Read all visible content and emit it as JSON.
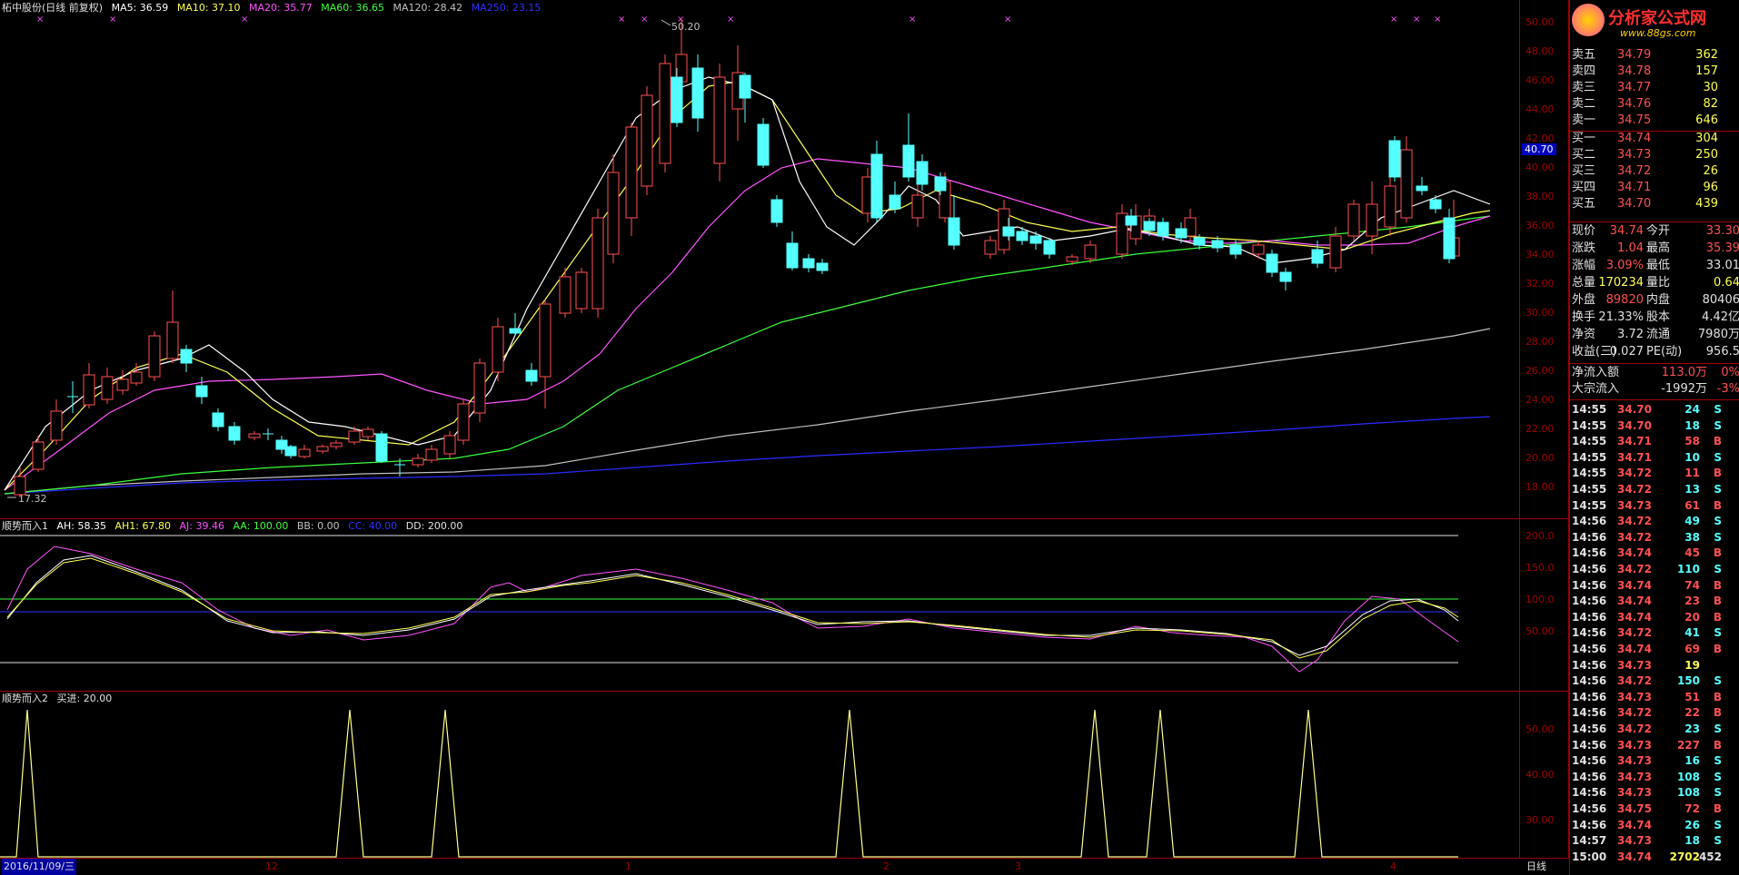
{
  "main_header": {
    "title": "柘中股份(日线 前复权)",
    "ma5": "MA5: 36.59",
    "ma10": "MA10: 37.10",
    "ma20": "MA20: 35.77",
    "ma60": "MA60: 36.65",
    "ma120": "MA120: 28.42",
    "ma250": "MA250: 23.15"
  },
  "ind1_header": {
    "title": "顺势而入1",
    "ah": "AH: 58.35",
    "ah1": "AH1: 67.80",
    "aj": "AJ: 39.46",
    "aa": "AA: 100.00",
    "bb": "BB: 0.00",
    "cc": "CC: 40.00",
    "dd": "DD: 200.00"
  },
  "ind2_header": {
    "title": "顺势而入2",
    "buy": "买进: 20.00"
  },
  "price_axis": [
    "50.00",
    "48.00",
    "46.00",
    "44.00",
    "42.00",
    "40.00",
    "38.00",
    "36.00",
    "34.00",
    "32.00",
    "30.00",
    "28.00",
    "26.00",
    "24.00",
    "22.00",
    "20.00",
    "18.00"
  ],
  "price_flag": "40.70",
  "high_label": "50.20",
  "low_label": "17.32",
  "ind1_axis": [
    "200.0",
    "150.0",
    "100.0",
    "50.00"
  ],
  "ind2_axis": [
    "50.00",
    "40.00",
    "30.00"
  ],
  "date_axis": {
    "start": "2016/11/09/三",
    "m12": "12",
    "m1": "1",
    "m2": "2",
    "m3": "3",
    "m4": "4"
  },
  "period_label": "日线",
  "logo": {
    "title": "分析家公式网",
    "url": "www.88gs.com"
  },
  "order_book": [
    {
      "label": "卖五",
      "price": "34.79",
      "vol": "362"
    },
    {
      "label": "卖四",
      "price": "34.78",
      "vol": "157"
    },
    {
      "label": "卖三",
      "price": "34.77",
      "vol": "30"
    },
    {
      "label": "卖二",
      "price": "34.76",
      "vol": "82"
    },
    {
      "label": "卖一",
      "price": "34.75",
      "vol": "646"
    },
    {
      "label": "买一",
      "price": "34.74",
      "vol": "304"
    },
    {
      "label": "买二",
      "price": "34.73",
      "vol": "250"
    },
    {
      "label": "买三",
      "price": "34.72",
      "vol": "26"
    },
    {
      "label": "买四",
      "price": "34.71",
      "vol": "96"
    },
    {
      "label": "买五",
      "price": "34.70",
      "vol": "439"
    }
  ],
  "stats": [
    {
      "l1": "现价",
      "v1": "34.74",
      "l2": "今开",
      "v2": "33.30",
      "c1": "red",
      "c2": "red"
    },
    {
      "l1": "涨跌",
      "v1": "1.04",
      "l2": "最高",
      "v2": "35.39",
      "c1": "red",
      "c2": "red"
    },
    {
      "l1": "涨幅",
      "v1": "3.09%",
      "l2": "最低",
      "v2": "33.01",
      "c1": "red",
      "c2": "wht"
    },
    {
      "l1": "总量",
      "v1": "170234",
      "l2": "量比",
      "v2": "0.64",
      "c1": "yel",
      "c2": "yel"
    },
    {
      "l1": "外盘",
      "v1": "89820",
      "l2": "内盘",
      "v2": "80406",
      "c1": "red",
      "c2": "wht"
    },
    {
      "l1": "换手",
      "v1": "21.33%",
      "l2": "股本",
      "v2": "4.42亿",
      "c1": "wht",
      "c2": "wht"
    },
    {
      "l1": "净资",
      "v1": "3.72",
      "l2": "流通",
      "v2": "7980万",
      "c1": "wht",
      "c2": "wht"
    },
    {
      "l1": "收益(三)",
      "v1": "0.027",
      "l2": "PE(动)",
      "v2": "956.5",
      "c1": "wht",
      "c2": "wht"
    }
  ],
  "flow": [
    {
      "label": "净流入额",
      "value": "113.0万",
      "pct": "0%"
    },
    {
      "label": "大宗流入",
      "value": "-1992万",
      "pct": "-3%"
    }
  ],
  "ticks": [
    {
      "t": "14:55",
      "p": "34.70",
      "v": "24",
      "s": "S"
    },
    {
      "t": "14:55",
      "p": "34.70",
      "v": "18",
      "s": "S"
    },
    {
      "t": "14:55",
      "p": "34.71",
      "v": "58",
      "s": "B"
    },
    {
      "t": "14:55",
      "p": "34.71",
      "v": "10",
      "s": "S"
    },
    {
      "t": "14:55",
      "p": "34.72",
      "v": "11",
      "s": "B"
    },
    {
      "t": "14:55",
      "p": "34.72",
      "v": "13",
      "s": "S"
    },
    {
      "t": "14:55",
      "p": "34.73",
      "v": "61",
      "s": "B"
    },
    {
      "t": "14:56",
      "p": "34.72",
      "v": "49",
      "s": "S"
    },
    {
      "t": "14:56",
      "p": "34.72",
      "v": "38",
      "s": "S"
    },
    {
      "t": "14:56",
      "p": "34.74",
      "v": "45",
      "s": "B"
    },
    {
      "t": "14:56",
      "p": "34.72",
      "v": "110",
      "s": "S"
    },
    {
      "t": "14:56",
      "p": "34.74",
      "v": "74",
      "s": "B"
    },
    {
      "t": "14:56",
      "p": "34.74",
      "v": "23",
      "s": "B"
    },
    {
      "t": "14:56",
      "p": "34.74",
      "v": "20",
      "s": "B"
    },
    {
      "t": "14:56",
      "p": "34.72",
      "v": "41",
      "s": "S"
    },
    {
      "t": "14:56",
      "p": "34.74",
      "v": "69",
      "s": "B"
    },
    {
      "t": "14:56",
      "p": "34.73",
      "v": "19",
      "s": ""
    },
    {
      "t": "14:56",
      "p": "34.72",
      "v": "150",
      "s": "S"
    },
    {
      "t": "14:56",
      "p": "34.73",
      "v": "51",
      "s": "B"
    },
    {
      "t": "14:56",
      "p": "34.72",
      "v": "22",
      "s": "B"
    },
    {
      "t": "14:56",
      "p": "34.72",
      "v": "23",
      "s": "S"
    },
    {
      "t": "14:56",
      "p": "34.73",
      "v": "227",
      "s": "B"
    },
    {
      "t": "14:56",
      "p": "34.73",
      "v": "16",
      "s": "S"
    },
    {
      "t": "14:56",
      "p": "34.73",
      "v": "108",
      "s": "S"
    },
    {
      "t": "14:56",
      "p": "34.73",
      "v": "108",
      "s": "S"
    },
    {
      "t": "14:56",
      "p": "34.75",
      "v": "72",
      "s": "B"
    },
    {
      "t": "14:56",
      "p": "34.74",
      "v": "26",
      "s": "S"
    },
    {
      "t": "14:57",
      "p": "34.73",
      "v": "18",
      "s": "S"
    },
    {
      "t": "15:00",
      "p": "34.74",
      "v": "2702",
      "s": "452"
    }
  ],
  "colors": {
    "up": "#ff5050",
    "down": "#54ffff",
    "ma5": "#ffffff",
    "ma10": "#ffff54",
    "ma20": "#ff54ff",
    "ma60": "#3cff3c",
    "ma120": "#c0c0c0",
    "ma250": "#3030ff",
    "frame": "#a00000"
  }
}
